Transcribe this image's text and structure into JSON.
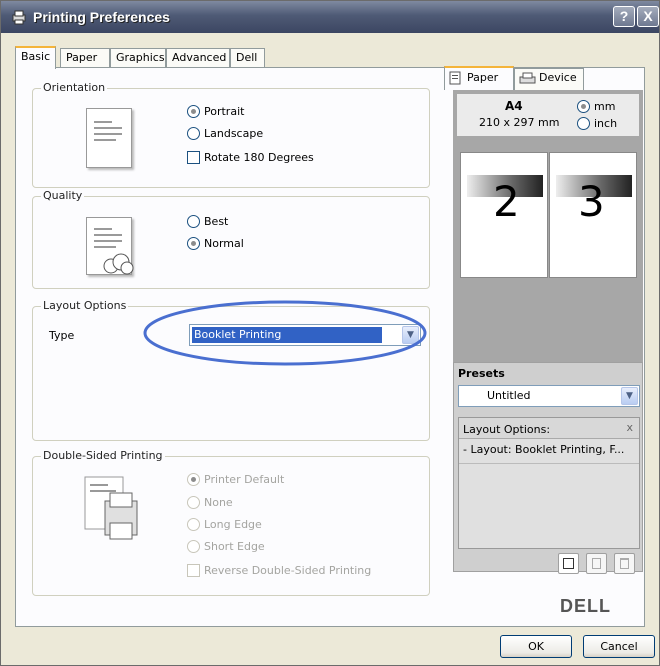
{
  "window": {
    "title": "Printing Preferences",
    "help_label": "?",
    "close_label": "X"
  },
  "tabs": [
    "Basic",
    "Paper",
    "Graphics",
    "Advanced",
    "Dell"
  ],
  "orientation": {
    "legend": "Orientation",
    "options": [
      "Portrait",
      "Landscape"
    ],
    "selected": "Portrait",
    "rotate_label": "Rotate 180 Degrees"
  },
  "quality": {
    "legend": "Quality",
    "options": [
      "Best",
      "Normal"
    ],
    "selected": "Normal"
  },
  "layout": {
    "legend": "Layout Options",
    "type_label": "Type",
    "type_value": "Booklet Printing",
    "highlight_color": "#4a6fd0"
  },
  "duplex": {
    "legend": "Double-Sided Printing",
    "options": [
      "Printer Default",
      "None",
      "Long Edge",
      "Short Edge"
    ],
    "selected": "Printer Default",
    "reverse_label": "Reverse Double-Sided Printing"
  },
  "preview": {
    "tabs": [
      "Paper",
      "Device"
    ],
    "paper_size": "A4",
    "paper_dims": "210 x 297 mm",
    "units": [
      "mm",
      "inch"
    ],
    "unit_selected": "mm",
    "pages": [
      "2",
      "3"
    ]
  },
  "presets": {
    "title": "Presets",
    "selected": "Untitled",
    "summary_header": "Layout Options:",
    "summary_close": "x",
    "summary_line": "- Layout: Booklet Printing, F..."
  },
  "brand": "DELL",
  "buttons": {
    "ok": "OK",
    "cancel": "Cancel"
  },
  "colors": {
    "titlebar": "#4e5a75",
    "preview_pane": "#a7a7a7",
    "tab_highlight": "#f4b43a"
  }
}
